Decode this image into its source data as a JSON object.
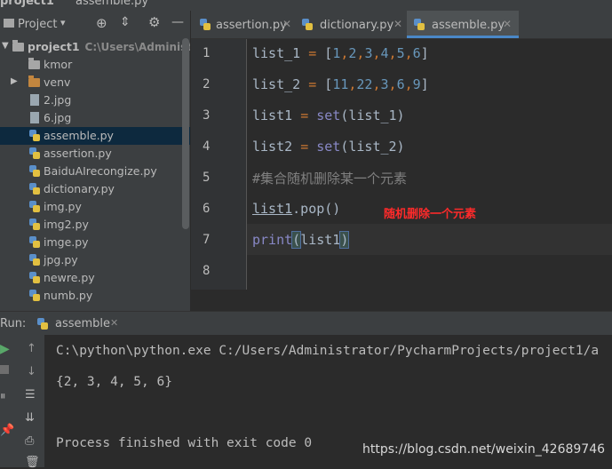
{
  "window": {
    "title": "project1",
    "file": "assemble.py"
  },
  "project_panel": {
    "title": "Project",
    "tree": [
      {
        "name": "project1",
        "hint": "C:\\Users\\Administrato",
        "type": "root-folder"
      },
      {
        "name": "kmor",
        "type": "folder"
      },
      {
        "name": "venv",
        "type": "folder-orange"
      },
      {
        "name": "2.jpg",
        "type": "file"
      },
      {
        "name": "6.jpg",
        "type": "file"
      },
      {
        "name": "assemble.py",
        "type": "python",
        "selected": true
      },
      {
        "name": "assertion.py",
        "type": "python"
      },
      {
        "name": "BaiduAIrecongize.py",
        "type": "python"
      },
      {
        "name": "dictionary.py",
        "type": "python"
      },
      {
        "name": "img.py",
        "type": "python"
      },
      {
        "name": "img2.py",
        "type": "python"
      },
      {
        "name": "imge.py",
        "type": "python"
      },
      {
        "name": "jpg.py",
        "type": "python"
      },
      {
        "name": "newre.py",
        "type": "python"
      },
      {
        "name": "numb.py",
        "type": "python"
      }
    ]
  },
  "tabs": [
    {
      "label": "assertion.py",
      "active": false
    },
    {
      "label": "dictionary.py",
      "active": false
    },
    {
      "label": "assemble.py",
      "active": true
    }
  ],
  "editor": {
    "line_numbers": [
      "1",
      "2",
      "3",
      "4",
      "5",
      "6",
      "7",
      "8"
    ],
    "lines": {
      "l1": {
        "var": "list_1",
        "eq": "=",
        "open": "[",
        "items": [
          "1",
          "2",
          "3",
          "4",
          "5",
          "6"
        ],
        "close": "]"
      },
      "l2": {
        "var": "list_2",
        "eq": "=",
        "open": "[",
        "items": [
          "11",
          "22",
          "3",
          "6",
          "9"
        ],
        "close": "]"
      },
      "l3": {
        "var": "list1",
        "eq": "=",
        "fn": "set",
        "arg": "(list_1)"
      },
      "l4": {
        "var": "list2",
        "eq": "=",
        "fn": "set",
        "arg": "(list_2)"
      },
      "l5": {
        "comment": "#集合随机删除某一个元素"
      },
      "l6": {
        "obj": "list1",
        "call": ".pop()"
      },
      "l7": {
        "fn": "print",
        "open": "(",
        "arg": "list1",
        "close": ")"
      }
    },
    "annotation": "随机删除一个元素"
  },
  "run_panel": {
    "label": "Run:",
    "config": "assemble",
    "output": [
      "C:\\python\\python.exe C:/Users/Administrator/PycharmProjects/project1/a",
      "{2, 3, 4, 5, 6}",
      "",
      "Process finished with exit code 0"
    ]
  },
  "watermark": "https://blog.csdn.net/weixin_42689746",
  "colors": {
    "accent": "#4a88c7",
    "annotation": "#ff2a2a",
    "keyword": "#cc7832",
    "number": "#6897bb"
  }
}
